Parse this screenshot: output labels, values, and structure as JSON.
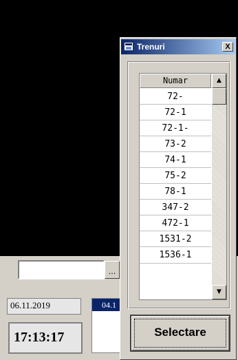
{
  "background_app": {
    "date": "06.11.2019",
    "time": "17:13:17",
    "dots_button": "...",
    "list_selected": "04.1"
  },
  "dialog": {
    "title": "Trenuri",
    "close_glyph": "X",
    "column_header": "Numar",
    "rows": [
      "72-",
      "72-1",
      "72-1-",
      "73-2",
      "74-1",
      "75-2",
      "78-1",
      "347-2",
      "472-1",
      "1531-2",
      "1536-1"
    ],
    "scroll_up_glyph": "▲",
    "scroll_down_glyph": "▼",
    "select_button": "Selectare"
  },
  "colors": {
    "title_bar_start": "#0a246a",
    "title_bar_end": "#a6caf0",
    "window_face": "#d4d0c8",
    "selection": "#0a246a"
  }
}
